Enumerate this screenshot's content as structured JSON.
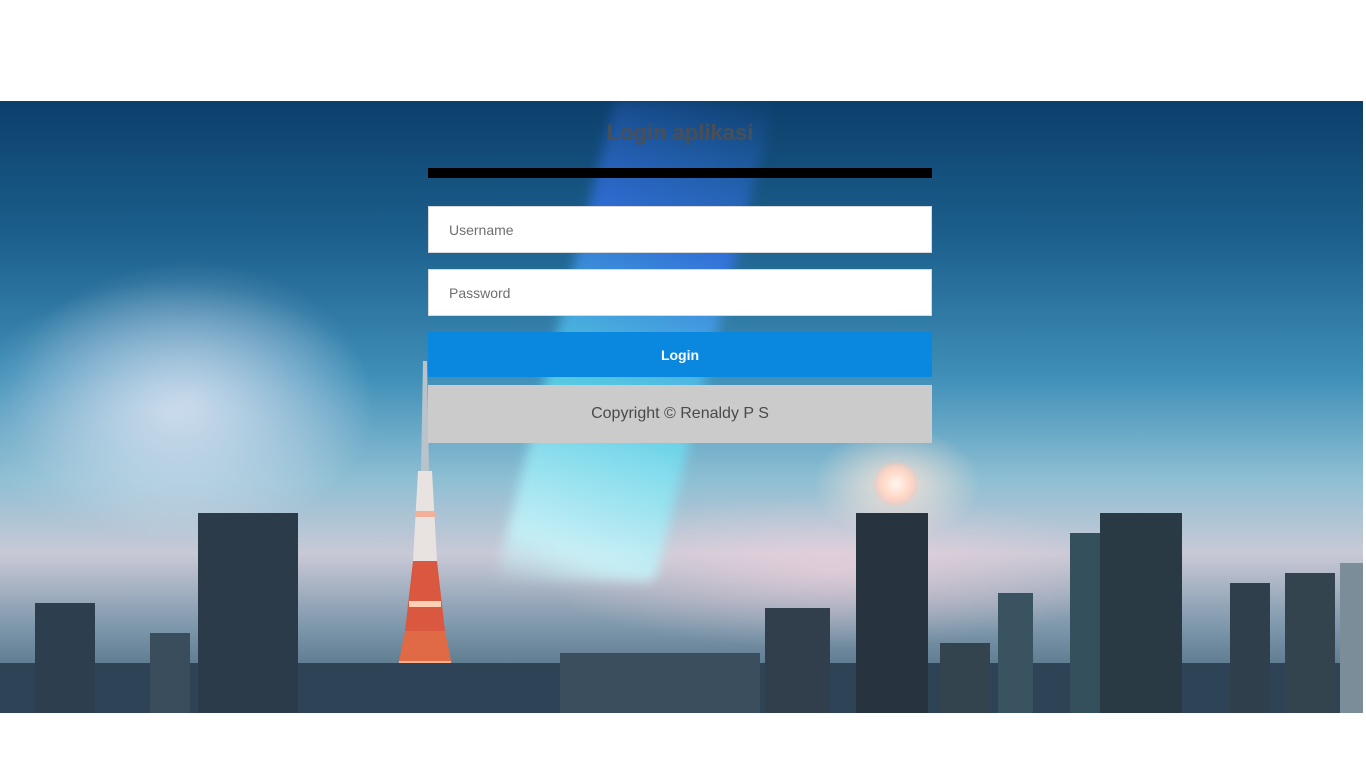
{
  "login": {
    "title": "Login aplikasi",
    "username_placeholder": "Username",
    "password_placeholder": "Password",
    "login_label": "Login",
    "copyright": "Copyright © Renaldy P S"
  },
  "colors": {
    "button": "#0a88df",
    "footer": "#cbcbcb",
    "rule": "#000000"
  },
  "background": {
    "description_icon": "city-skyline-image"
  }
}
